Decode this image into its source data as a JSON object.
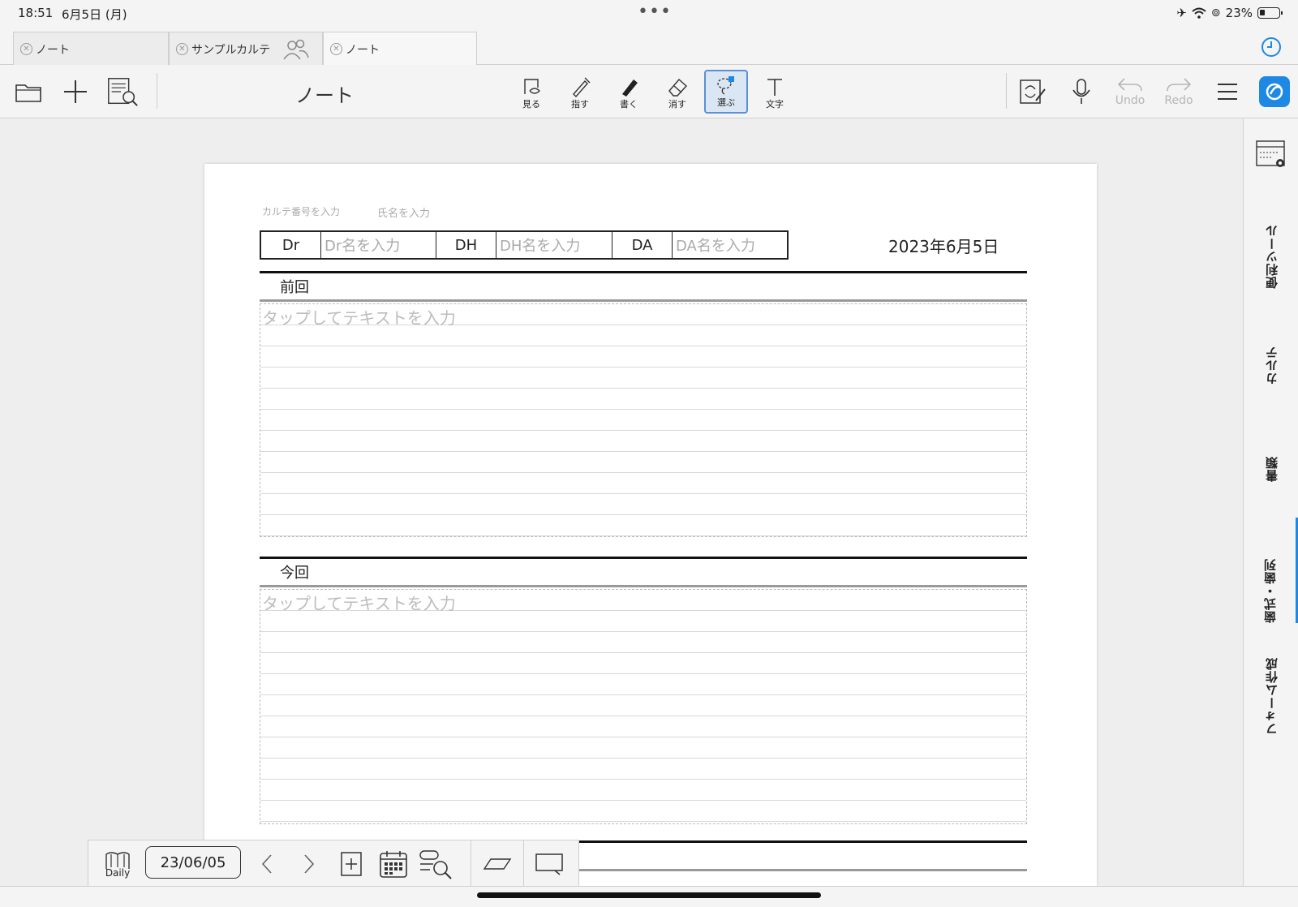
{
  "status_bar": {
    "time": "18:51",
    "date": "6月5日 (月)",
    "battery": "23%"
  },
  "tabs": [
    {
      "label": "ノート"
    },
    {
      "label": "サンプルカルテ"
    },
    {
      "label": "ノート"
    }
  ],
  "toolbar": {
    "title": "ノート",
    "tools": [
      {
        "label": "見る"
      },
      {
        "label": "指す"
      },
      {
        "label": "書く"
      },
      {
        "label": "消す"
      },
      {
        "label": "選ぶ"
      },
      {
        "label": "文字"
      }
    ],
    "undo_label": "Undo",
    "redo_label": "Redo"
  },
  "sidebar": {
    "tabs": [
      {
        "label": "便利ツール"
      },
      {
        "label": "カルテ"
      },
      {
        "label": "書類"
      },
      {
        "label": "歯式・歯列"
      },
      {
        "label": "フォーム作成"
      }
    ]
  },
  "page": {
    "placeholders": {
      "karte_number": "カルテ番号を入力",
      "patient_name": "氏名を入力"
    },
    "staff": [
      {
        "label": "Dr",
        "placeholder": "Dr名を入力"
      },
      {
        "label": "DH",
        "placeholder": "DH名を入力"
      },
      {
        "label": "DA",
        "placeholder": "DA名を入力"
      }
    ],
    "date": "2023年6月5日",
    "sections": [
      {
        "title": "前回",
        "hint": "タップしてテキストを入力"
      },
      {
        "title": "今回",
        "hint": "タップしてテキストを入力"
      }
    ]
  },
  "bottom_bar": {
    "daily_label": "Daily",
    "date": "23/06/05"
  },
  "colors": {
    "accent": "#1e88e5",
    "selected_tool_bg": "#dbe6f4"
  }
}
